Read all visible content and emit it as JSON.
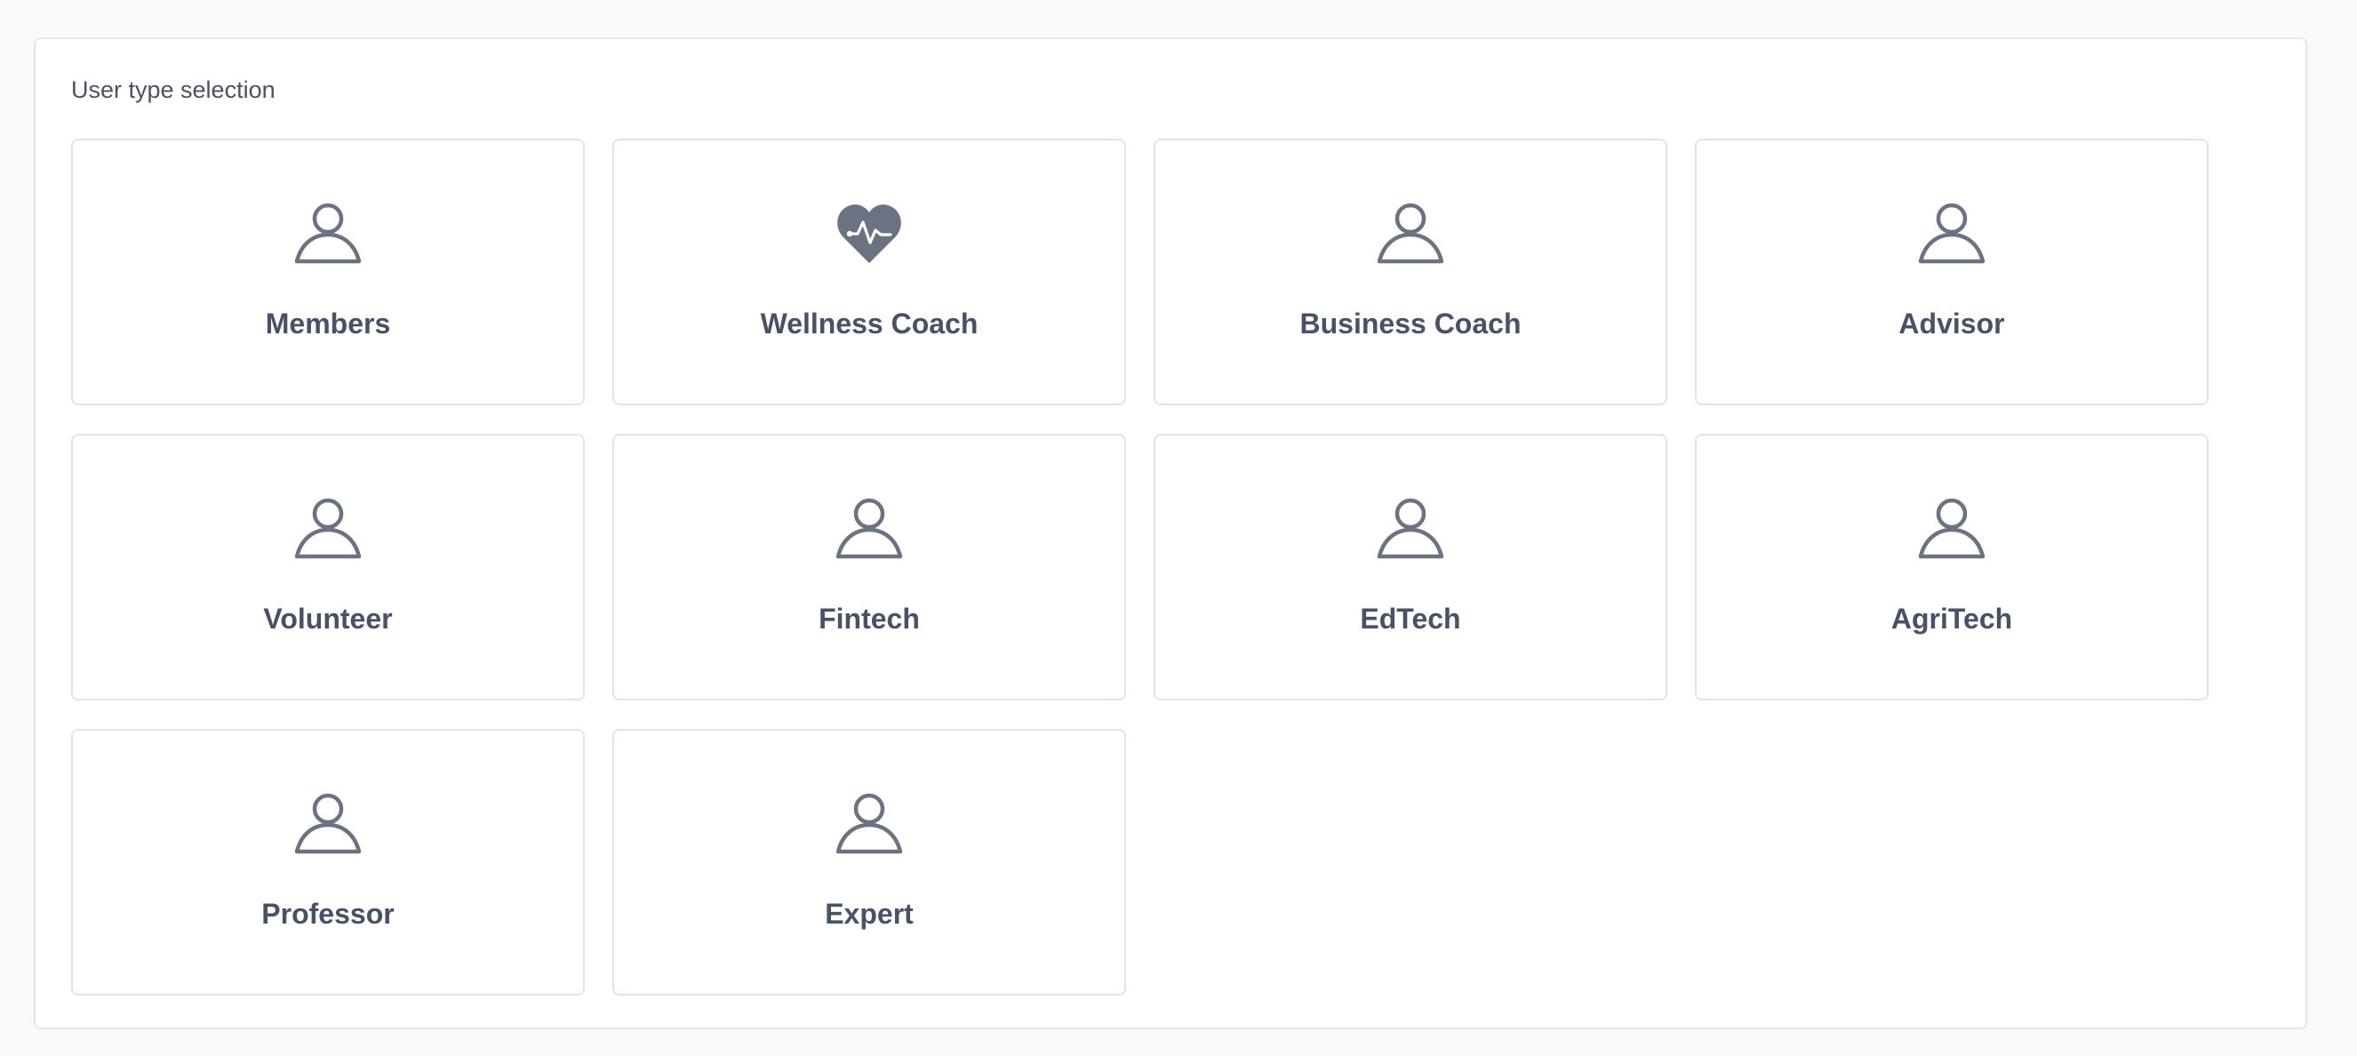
{
  "section": {
    "label": "User type selection"
  },
  "user_types": [
    {
      "label": "Members",
      "icon": "user-icon"
    },
    {
      "label": "Wellness Coach",
      "icon": "heart-pulse-icon"
    },
    {
      "label": "Business Coach",
      "icon": "user-icon"
    },
    {
      "label": "Advisor",
      "icon": "user-icon"
    },
    {
      "label": "Volunteer",
      "icon": "user-icon"
    },
    {
      "label": "Fintech",
      "icon": "user-icon"
    },
    {
      "label": "EdTech",
      "icon": "user-icon"
    },
    {
      "label": "AgriTech",
      "icon": "user-icon"
    },
    {
      "label": "Professor",
      "icon": "user-icon"
    },
    {
      "label": "Expert",
      "icon": "user-icon"
    }
  ],
  "colors": {
    "icon": "#6b7282",
    "label": "#475266",
    "card_border": "#e1e4e9",
    "background": "#f8f9fb"
  }
}
